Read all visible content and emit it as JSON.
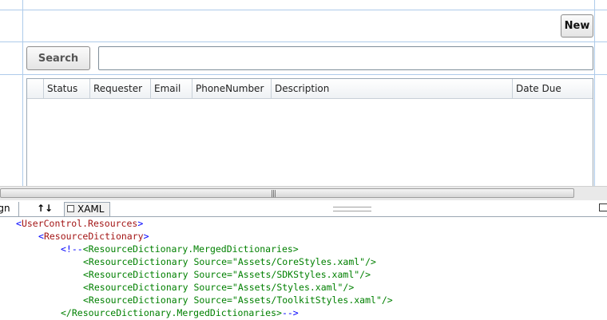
{
  "designer": {
    "new_button": "New",
    "search_button": "Search",
    "search_value": "",
    "columns": [
      "",
      "Status",
      "Requester",
      "Email",
      "PhoneNumber",
      "Description",
      "Date Due"
    ]
  },
  "splitter": {
    "grip": "|||"
  },
  "tabs": {
    "design": "ign",
    "swap": "↑↓",
    "xaml": "XAML"
  },
  "code": [
    {
      "indent": 0,
      "parts": [
        [
          "p",
          "<"
        ],
        [
          "t",
          "UserControl.Resources"
        ],
        [
          "p",
          ">"
        ]
      ]
    },
    {
      "indent": 1,
      "parts": [
        [
          "p",
          "<"
        ],
        [
          "t",
          "ResourceDictionary"
        ],
        [
          "p",
          ">"
        ]
      ]
    },
    {
      "indent": 2,
      "parts": [
        [
          "p",
          "<!--"
        ],
        [
          "c",
          "<ResourceDictionary.MergedDictionaries>"
        ]
      ]
    },
    {
      "indent": 3,
      "parts": [
        [
          "c",
          "<ResourceDictionary Source=\"Assets/CoreStyles.xaml\"/>"
        ]
      ]
    },
    {
      "indent": 3,
      "parts": [
        [
          "c",
          "<ResourceDictionary Source=\"Assets/SDKStyles.xaml\"/>"
        ]
      ]
    },
    {
      "indent": 3,
      "parts": [
        [
          "c",
          "<ResourceDictionary Source=\"Assets/Styles.xaml\"/>"
        ]
      ]
    },
    {
      "indent": 3,
      "parts": [
        [
          "c",
          "<ResourceDictionary Source=\"Assets/ToolkitStyles.xaml\"/>"
        ]
      ]
    },
    {
      "indent": 2,
      "parts": [
        [
          "c",
          "</ResourceDictionary.MergedDictionaries>"
        ],
        [
          "p",
          "-->"
        ]
      ]
    }
  ],
  "colors": {
    "grid_lines": "#aecbea",
    "xml_tag": "#a31515",
    "xml_punct": "#0000ff",
    "comment": "#008000"
  }
}
